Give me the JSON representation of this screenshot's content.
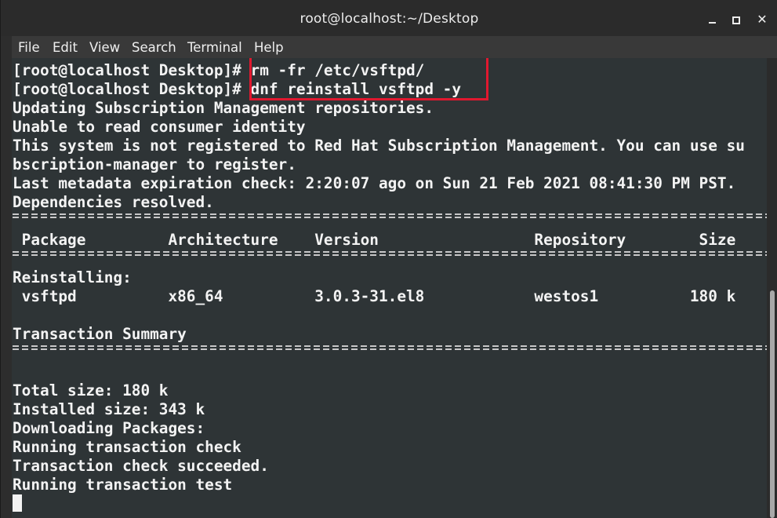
{
  "window": {
    "title": "root@localhost:~/Desktop",
    "controls": {
      "minimize": "minimize-icon",
      "maximize": "maximize-icon",
      "close": "close-icon"
    }
  },
  "menu": [
    "File",
    "Edit",
    "View",
    "Search",
    "Terminal",
    "Help"
  ],
  "terminal": {
    "lines": [
      "[root@localhost Desktop]# rm -fr /etc/vsftpd/",
      "[root@localhost Desktop]# dnf reinstall vsftpd -y",
      "Updating Subscription Management repositories.",
      "Unable to read consumer identity",
      "This system is not registered to Red Hat Subscription Management. You can use su",
      "bscription-manager to register.",
      "Last metadata expiration check: 2:20:07 ago on Sun 21 Feb 2021 08:41:30 PM PST.",
      "Dependencies resolved.",
      "",
      " Package         Architecture    Version                 Repository        Size",
      "",
      "Reinstalling:",
      " vsftpd          x86_64          3.0.3-31.el8            westos1          180 k",
      "",
      "Transaction Summary",
      "",
      "",
      "Total size: 180 k",
      "Installed size: 343 k",
      "Downloading Packages:",
      "Running transaction check",
      "Transaction check succeeded.",
      "Running transaction test"
    ]
  },
  "colors": {
    "terminal_bg": "#2e3436",
    "terminal_fg": "#f3f3f3",
    "highlight_border": "#e1182f",
    "titlebar_bg": "#2b2b2b",
    "menubar_bg": "#393939"
  }
}
